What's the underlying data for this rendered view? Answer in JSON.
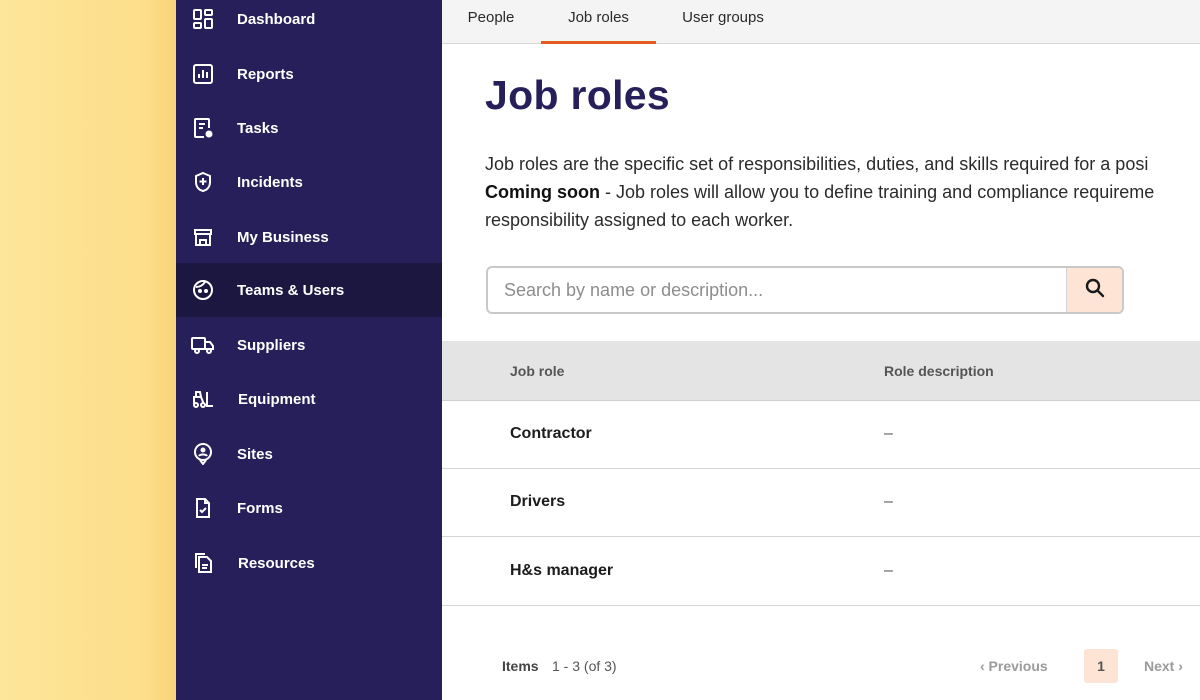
{
  "sidebar": {
    "items": [
      {
        "label": "Dashboard",
        "icon": "dashboard-icon",
        "active": false
      },
      {
        "label": "Reports",
        "icon": "reports-icon",
        "active": false
      },
      {
        "label": "Tasks",
        "icon": "tasks-icon",
        "active": false
      },
      {
        "label": "Incidents",
        "icon": "incidents-shield-icon",
        "active": false
      },
      {
        "label": "My Business",
        "icon": "store-icon",
        "active": false
      },
      {
        "label": "Teams & Users",
        "icon": "face-icon",
        "active": true
      },
      {
        "label": "Suppliers",
        "icon": "truck-icon",
        "active": false
      },
      {
        "label": "Equipment",
        "icon": "forklift-icon",
        "active": false
      },
      {
        "label": "Sites",
        "icon": "location-pin-icon",
        "active": false
      },
      {
        "label": "Forms",
        "icon": "form-check-icon",
        "active": false
      },
      {
        "label": "Resources",
        "icon": "documents-icon",
        "active": false
      }
    ]
  },
  "tabs": [
    {
      "label": "People",
      "active": false
    },
    {
      "label": "Job roles",
      "active": true
    },
    {
      "label": "User groups",
      "active": false
    }
  ],
  "page": {
    "title": "Job roles",
    "desc_line1": "Job roles are the specific set of responsibilities, duties, and skills required for a posi",
    "desc_bold": "Coming soon",
    "desc_line2_rest": " - Job roles will allow you to define training and compliance requireme",
    "desc_line3": "responsibility assigned to each worker."
  },
  "search": {
    "placeholder": "Search by name or description...",
    "value": ""
  },
  "table": {
    "columns": [
      "Job role",
      "Role description"
    ],
    "rows": [
      {
        "name": "Contractor",
        "description": "–"
      },
      {
        "name": "Drivers",
        "description": "–"
      },
      {
        "name": "H&s manager",
        "description": "–"
      }
    ]
  },
  "pagination": {
    "items_label": "Items",
    "items_range": "1 - 3 (of 3)",
    "previous": "‹  Previous",
    "current_page": "1",
    "next": "Next  ›"
  },
  "colors": {
    "sidebar_bg": "#271f5a",
    "sidebar_active_bg": "#1c1740",
    "accent": "#e35b1e",
    "title": "#271f5a",
    "search_button_bg": "#fde4d5",
    "backdrop": "#fde08c"
  }
}
